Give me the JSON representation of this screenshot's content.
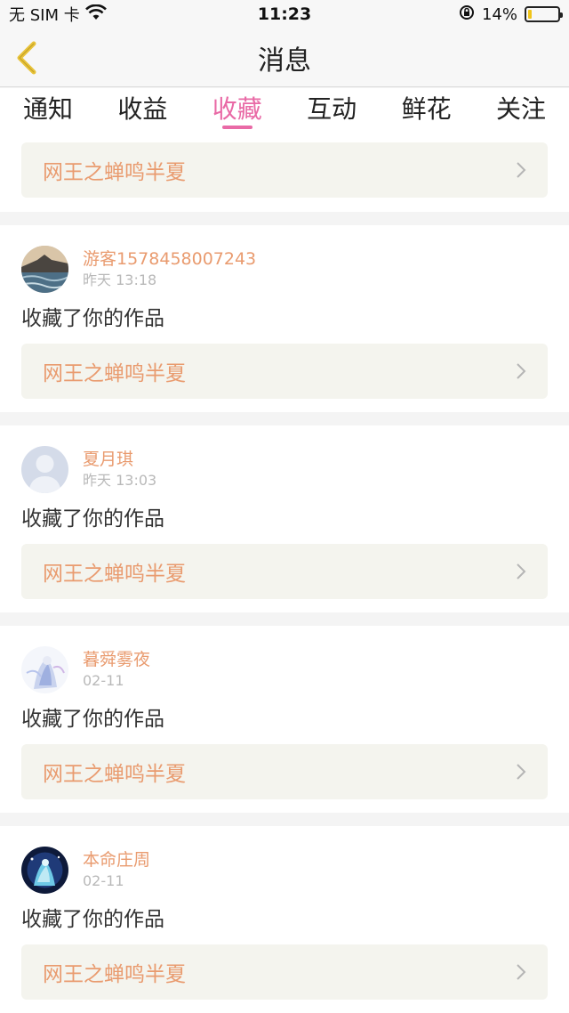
{
  "status_bar": {
    "carrier": "无 SIM 卡",
    "time": "11:23",
    "battery_text": "14%",
    "battery_level": 0.14
  },
  "nav": {
    "title": "消息"
  },
  "tabs": [
    {
      "label": "通知",
      "active": false
    },
    {
      "label": "收益",
      "active": false
    },
    {
      "label": "收藏",
      "active": true
    },
    {
      "label": "互动",
      "active": false
    },
    {
      "label": "鲜花",
      "active": false
    },
    {
      "label": "关注",
      "active": false
    }
  ],
  "first_item": {
    "work_title": "网王之蝉鸣半夏"
  },
  "items": [
    {
      "user": "游客1578458007243",
      "time": "昨天 13:18",
      "action": "收藏了你的作品",
      "work_title": "网王之蝉鸣半夏"
    },
    {
      "user": "夏月琪",
      "time": "昨天 13:03",
      "action": "收藏了你的作品",
      "work_title": "网王之蝉鸣半夏"
    },
    {
      "user": "暮舜雾夜",
      "time": "02-11",
      "action": "收藏了你的作品",
      "work_title": "网王之蝉鸣半夏"
    },
    {
      "user": "本命庄周",
      "time": "02-11",
      "action": "收藏了你的作品",
      "work_title": "网王之蝉鸣半夏"
    }
  ],
  "colors": {
    "accent_pink": "#e96aa6",
    "name_orange": "#e99b6f",
    "back_yellow": "#e8c33a"
  }
}
